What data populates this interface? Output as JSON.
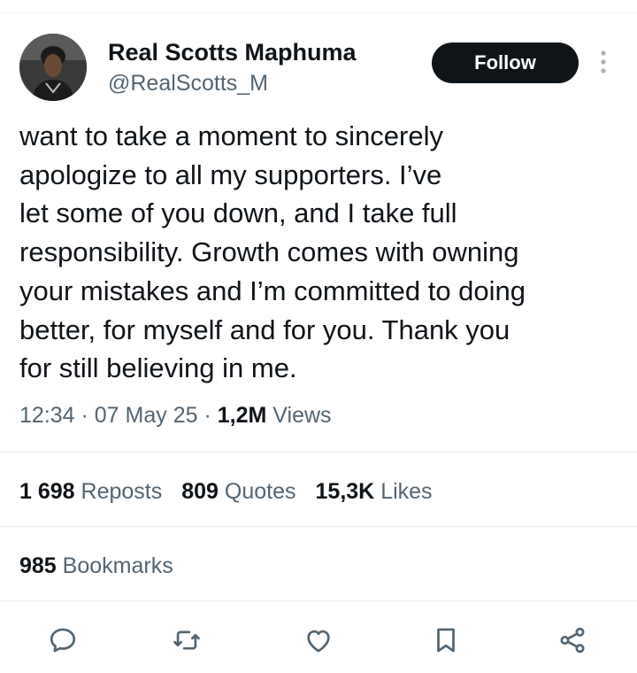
{
  "author": {
    "display_name": "Real Scotts Maphuma",
    "handle": "@RealScotts_M",
    "avatar_icon": "profile-photo"
  },
  "follow_label": "Follow",
  "tweet": {
    "text": "want to take a moment to sincerely\napologize to all my supporters. I’ve\nlet some of you down, and I take full\nresponsibility. Growth comes with owning\nyour mistakes and I’m committed to doing\nbetter, for myself and for you. Thank you\nfor still believing in me."
  },
  "meta": {
    "time": "12:34",
    "sep1": " · ",
    "date": "07 May 25",
    "sep2": " · ",
    "views_count": "1,2M",
    "views_label": " Views"
  },
  "stats": {
    "reposts": {
      "count": "1 698",
      "label": "Reposts"
    },
    "quotes": {
      "count": "809",
      "label": "Quotes"
    },
    "likes": {
      "count": "15,3K",
      "label": "Likes"
    },
    "bookmarks": {
      "count": "985",
      "label": "Bookmarks"
    }
  },
  "action_icons": [
    "reply-icon",
    "repost-icon",
    "like-icon",
    "bookmark-icon",
    "share-icon"
  ],
  "colors": {
    "text": "#0f1419",
    "secondary": "#536471",
    "follow_bg": "#0f1419",
    "divider": "#e6ecf0"
  }
}
